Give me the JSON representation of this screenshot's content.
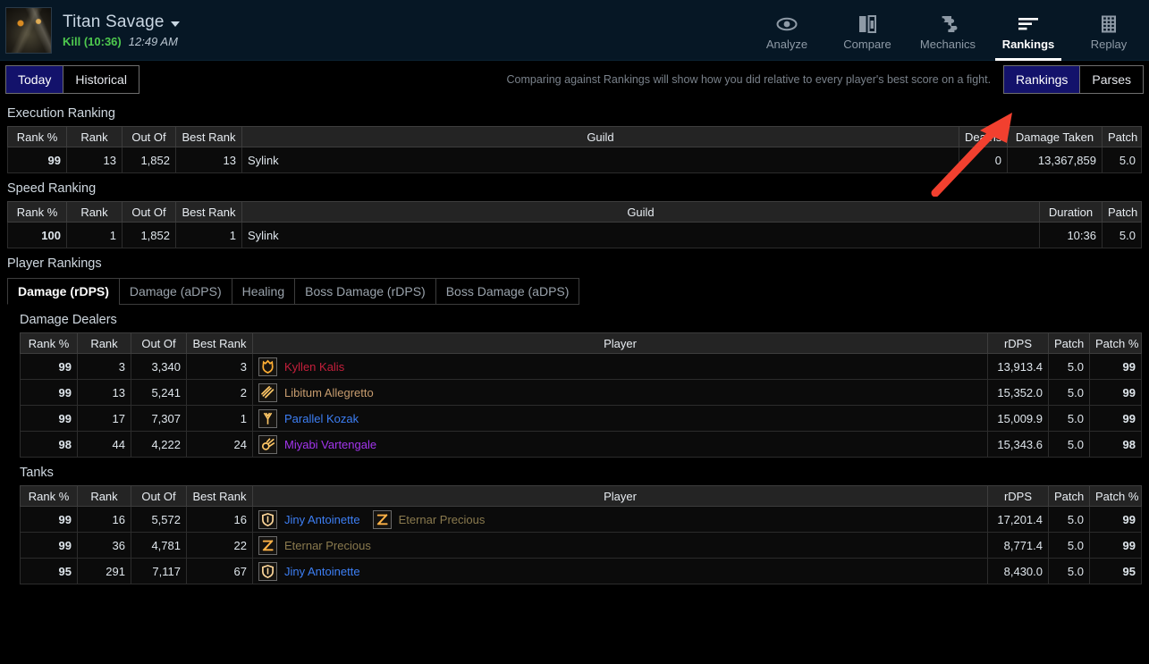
{
  "header": {
    "avatar_name": "boss-portrait",
    "fight_title": "Titan Savage",
    "kill_status": "Kill (10:36)",
    "time": "12:49 AM",
    "nav": [
      {
        "label": "Analyze",
        "icon": "eye-icon",
        "active": false
      },
      {
        "label": "Compare",
        "icon": "compare-icon",
        "active": false
      },
      {
        "label": "Mechanics",
        "icon": "puzzle-icon",
        "active": false
      },
      {
        "label": "Rankings",
        "icon": "bars-icon",
        "active": true
      },
      {
        "label": "Replay",
        "icon": "film-icon",
        "active": false
      }
    ]
  },
  "toolbar": {
    "left_buttons": [
      {
        "label": "Today",
        "selected": true
      },
      {
        "label": "Historical",
        "selected": false
      }
    ],
    "note": "Comparing against Rankings will show how you did relative to every player's best score on a fight.",
    "right_buttons": [
      {
        "label": "Rankings",
        "selected": true
      },
      {
        "label": "Parses",
        "selected": false
      }
    ]
  },
  "execution_ranking": {
    "title": "Execution Ranking",
    "columns": [
      "Rank %",
      "Rank",
      "Out Of",
      "Best Rank",
      "Guild",
      "Deaths",
      "Damage Taken",
      "Patch"
    ],
    "rows": [
      {
        "rank_pct": "99",
        "rank": "13",
        "out_of": "1,852",
        "best_rank": "13",
        "guild": "Sylink",
        "deaths": "0",
        "damage_taken": "13,367,859",
        "patch": "5.0"
      }
    ]
  },
  "speed_ranking": {
    "title": "Speed Ranking",
    "columns": [
      "Rank %",
      "Rank",
      "Out Of",
      "Best Rank",
      "Guild",
      "Duration",
      "Patch"
    ],
    "rows": [
      {
        "rank_pct": "100",
        "rank": "1",
        "out_of": "1,852",
        "best_rank": "1",
        "guild": "Sylink",
        "duration": "10:36",
        "patch": "5.0"
      }
    ]
  },
  "player_rankings": {
    "title": "Player Rankings",
    "tabs": [
      {
        "label": "Damage (rDPS)",
        "active": true
      },
      {
        "label": "Damage (aDPS)",
        "active": false
      },
      {
        "label": "Healing",
        "active": false
      },
      {
        "label": "Boss Damage (rDPS)",
        "active": false
      },
      {
        "label": "Boss Damage (aDPS)",
        "active": false
      }
    ],
    "groups": [
      {
        "title": "Damage Dealers",
        "columns": [
          "Rank %",
          "Rank",
          "Out Of",
          "Best Rank",
          "Player",
          "rDPS",
          "Patch",
          "Patch %"
        ],
        "rows": [
          {
            "rank_pct": "99",
            "rank": "3",
            "out_of": "3,340",
            "best_rank": "3",
            "player": "Kyllen Kalis",
            "player_color": "#c41f3b",
            "icon": "class-icon-paladin",
            "rdps": "13,913.4",
            "patch": "5.0",
            "patch_pct": "99"
          },
          {
            "rank_pct": "99",
            "rank": "13",
            "out_of": "5,241",
            "best_rank": "2",
            "player": "Libitum Allegretto",
            "player_color": "#c79c6e",
            "icon": "class-icon-monk",
            "rdps": "15,352.0",
            "patch": "5.0",
            "patch_pct": "99"
          },
          {
            "rank_pct": "99",
            "rank": "17",
            "out_of": "7,307",
            "best_rank": "1",
            "player": "Parallel Kozak",
            "player_color": "#3d7ff5",
            "icon": "class-icon-dragoon",
            "rdps": "15,009.9",
            "patch": "5.0",
            "patch_pct": "99"
          },
          {
            "rank_pct": "98",
            "rank": "44",
            "out_of": "4,222",
            "best_rank": "24",
            "player": "Miyabi Vartengale",
            "player_color": "#a335ee",
            "icon": "class-icon-machinist",
            "rdps": "15,343.6",
            "patch": "5.0",
            "patch_pct": "98"
          }
        ]
      },
      {
        "title": "Tanks",
        "columns": [
          "Rank %",
          "Rank",
          "Out Of",
          "Best Rank",
          "Player",
          "rDPS",
          "Patch",
          "Patch %"
        ],
        "rows": [
          {
            "rank_pct": "99",
            "rank": "16",
            "out_of": "5,572",
            "best_rank": "16",
            "player": "Jiny Antoinette",
            "player_color": "#3d7ff5",
            "icon": "class-icon-shield",
            "second_player": "Eternar Precious",
            "second_player_color": "#8a7a4e",
            "second_icon": "class-icon-zodiac",
            "rdps": "17,201.4",
            "patch": "5.0",
            "patch_pct": "99"
          },
          {
            "rank_pct": "99",
            "rank": "36",
            "out_of": "4,781",
            "best_rank": "22",
            "player": "Eternar Precious",
            "player_color": "#8a7a4e",
            "icon": "class-icon-zodiac",
            "rdps": "8,771.4",
            "patch": "5.0",
            "patch_pct": "99"
          },
          {
            "rank_pct": "95",
            "rank": "291",
            "out_of": "7,117",
            "best_rank": "67",
            "player": "Jiny Antoinette",
            "player_color": "#3d7ff5",
            "icon": "class-icon-shield",
            "rdps": "8,430.0",
            "patch": "5.0",
            "patch_pct": "95"
          }
        ]
      }
    ]
  },
  "annotation": {
    "arrow_color": "#f2402f",
    "points_to": "Rankings"
  },
  "colors": {
    "header_bg": "#061725",
    "rank_orange": "#ff8000",
    "rank_gold": "#e5cc80",
    "green": "#74e86b",
    "selected_blue": "#13126b"
  }
}
